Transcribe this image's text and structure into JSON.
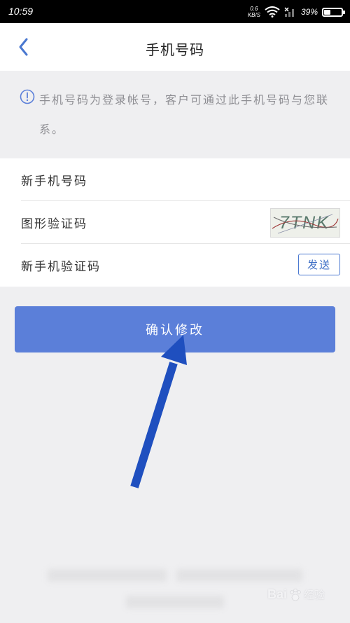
{
  "status_bar": {
    "time": "10:59",
    "net_speed": "0.6",
    "net_unit": "KB/S",
    "battery_percent": "39%",
    "battery_level": 0.39
  },
  "nav": {
    "title": "手机号码",
    "back_icon": "chevron-left-icon"
  },
  "notice": {
    "icon": "info-circle-icon",
    "text": "手机号码为登录帐号，客户可通过此手机号码与您联系。"
  },
  "form": {
    "new_phone_label": "新手机号码",
    "captcha_label": "图形验证码",
    "captcha_text": "7TNK",
    "sms_code_label": "新手机验证码",
    "send_label": "发送"
  },
  "confirm_button": "确认修改",
  "watermark": {
    "logo": "Bai",
    "text": "经验"
  },
  "colors": {
    "primary": "#5b7fd9",
    "accent_blue": "#3f6fc6",
    "annotation_arrow": "#1f4fbf",
    "page_bg": "#efeff1"
  }
}
